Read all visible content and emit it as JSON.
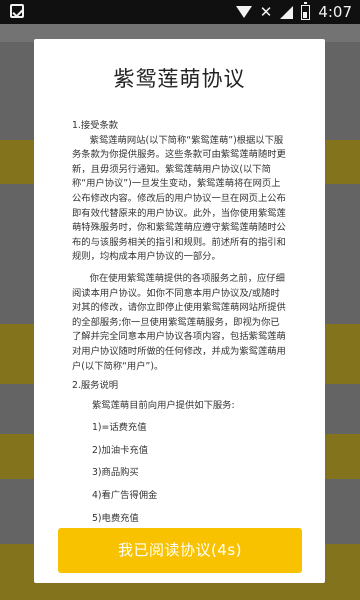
{
  "status_bar": {
    "time": "4:07",
    "icons": [
      "app-check-icon",
      "wifi-icon",
      "no-signal-icon",
      "signal-icon",
      "battery-icon"
    ],
    "no_signal_glyph": "✕"
  },
  "dialog": {
    "title": "紫鸳莲萌协议",
    "sections": [
      {
        "heading": "1.接受条款",
        "paragraphs": [
          "紫鸳莲萌网站(以下简称“紫鸳莲萌”)根据以下服务条款为你提供服务。这些条款可由紫鸳莲萌随时更新，且毋须另行通知。紫鸳莲萌用户协议(以下简称“用户协议”)一旦发生变动，紫鸳莲萌将在网页上公布修改内容。修改后的用户协议一旦在网页上公布即有效代替原来的用户协议。此外，当你使用紫鸳莲萌特殊服务时，你和紫鸳莲萌应遵守紫鸳莲萌随时公布的与该服务相关的指引和规则。前述所有的指引和规则，均构成本用户协议的一部分。",
          "你在使用紫鸳莲萌提供的各项服务之前，应仔细阅读本用户协议。如你不同意本用户协议及/或随时对其的修改，请你立即停止使用紫鸳莲萌网站所提供的全部服务;你一旦使用紫鸳莲萌服务，即视为你已了解并完全同意本用户协议各项内容，包括紫鸳莲萌对用户协议随时所做的任何修改，并成为紫鸳莲萌用户(以下简称“用户”)。"
        ]
      },
      {
        "heading": "2.服务说明",
        "intro": "紫鸳莲萌目前向用户提供如下服务:",
        "items": [
          "1)=话费充值",
          "2)加油卡充值",
          "3)商品购买",
          "4)看广告得佣金",
          "5)电费充值"
        ]
      }
    ],
    "confirm_button": "我已阅读协议(4s)"
  },
  "colors": {
    "accent": "#f8c200",
    "overlay": "#5f5f5f",
    "dialog_bg": "#ffffff"
  }
}
